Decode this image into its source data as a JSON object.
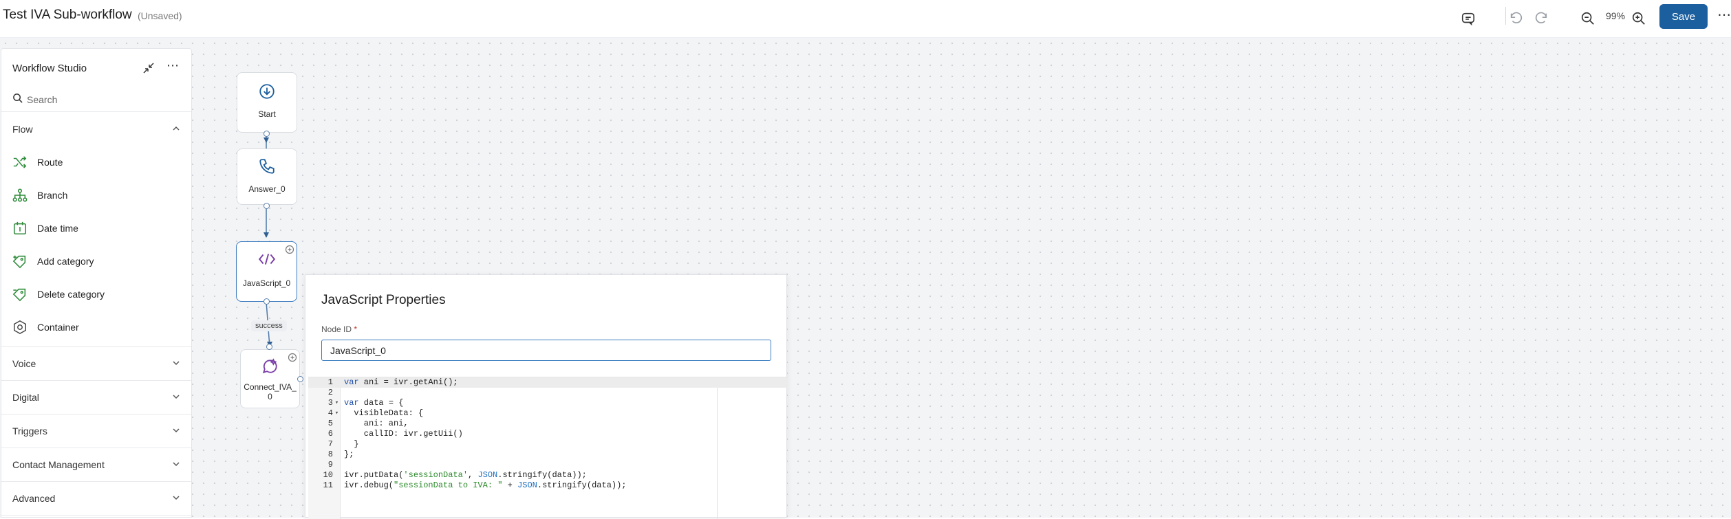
{
  "header": {
    "title": "Test IVA Sub-workflow",
    "status": "(Unsaved)",
    "zoom": "99%",
    "save_label": "Save",
    "more_label": "⋯"
  },
  "sidebar": {
    "title": "Workflow Studio",
    "more_label": "⋯",
    "search_placeholder": "Search",
    "flow_section": "Flow",
    "flow_items": [
      {
        "label": "Route",
        "icon": "route-icon"
      },
      {
        "label": "Branch",
        "icon": "branch-icon"
      },
      {
        "label": "Date time",
        "icon": "calendar-icon"
      },
      {
        "label": "Add category",
        "icon": "tag-add-icon"
      },
      {
        "label": "Delete category",
        "icon": "tag-delete-icon"
      },
      {
        "label": "Container",
        "icon": "container-icon"
      }
    ],
    "sections": [
      "Voice",
      "Digital",
      "Triggers",
      "Contact Management",
      "Advanced"
    ]
  },
  "nodes": {
    "start": "Start",
    "answer": "Answer_0",
    "javascript": "JavaScript_0",
    "connect_line1": "Connect_IVA_",
    "connect_line2": "0",
    "edge_label": "success"
  },
  "panel": {
    "title": "JavaScript Properties",
    "node_id_label": "Node ID",
    "required_mark": "*",
    "node_id_value": "JavaScript_0",
    "code": {
      "l1_kw": "var",
      "l1_rest": " ani = ivr.getAni();",
      "l3_kw": "var",
      "l3_rest": " data = {",
      "l4": "  visibleData: {",
      "l5": "    ani: ani,",
      "l6": "    callID: ivr.getUii()",
      "l7": "  }",
      "l8": "};",
      "l10_a": "ivr.putData(",
      "l10_str": "'sessionData'",
      "l10_b": ", ",
      "l10_obj": "JSON",
      "l10_c": ".stringify(data));",
      "l11_a": "ivr.debug(",
      "l11_str": "\"sessionData to IVA: \"",
      "l11_b": " + ",
      "l11_obj": "JSON",
      "l11_c": ".stringify(data));"
    }
  },
  "colors": {
    "accent": "#1c5f9e",
    "flow_icon": "#2e8b3a",
    "js_icon": "#7b3fa8",
    "start_icon": "#1c5f9e"
  }
}
